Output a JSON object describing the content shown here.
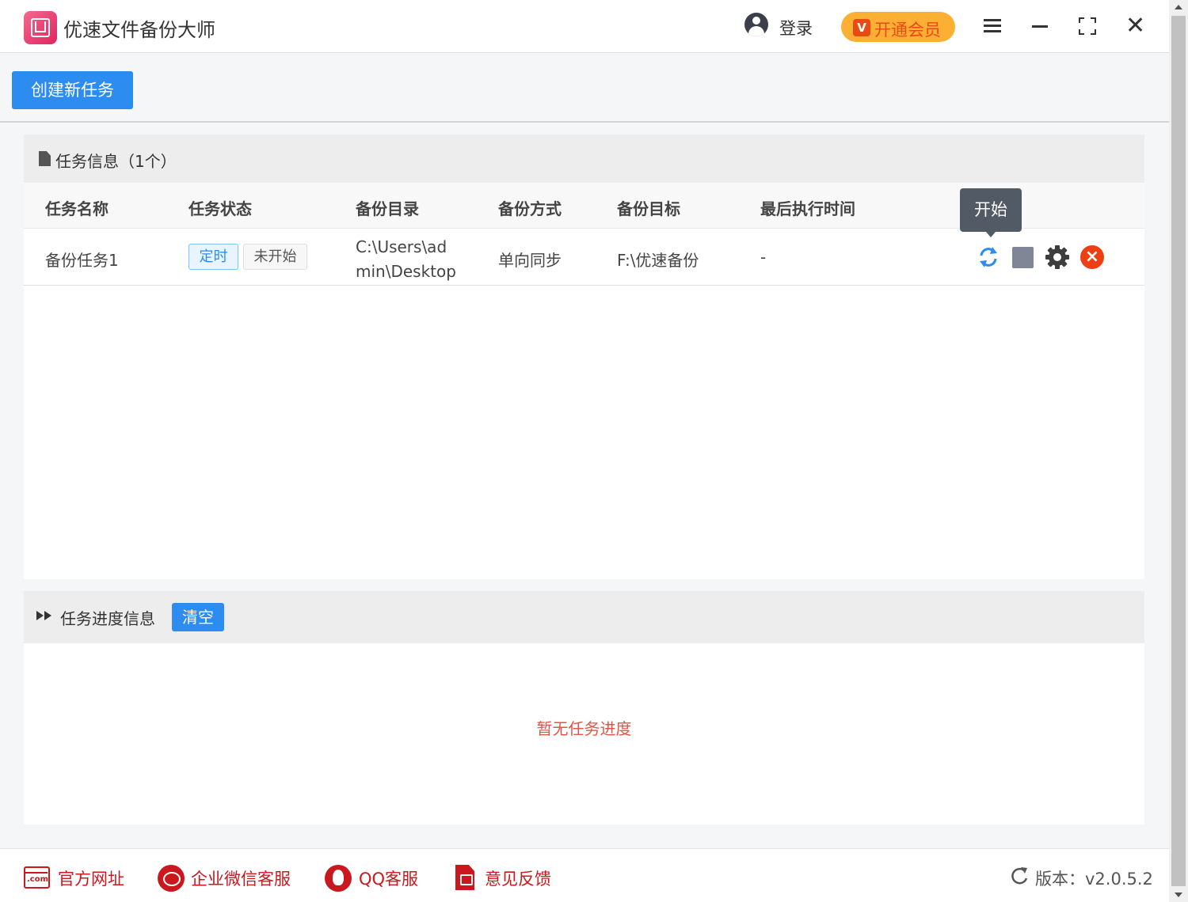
{
  "app": {
    "title": "优速文件备份大师",
    "login_label": "登录",
    "vip_label": "开通会员",
    "vip_badge": "V",
    "close_glyph": "✕"
  },
  "toolbar": {
    "create_task_label": "创建新任务"
  },
  "task_panel": {
    "title": "任务信息（1个）",
    "columns": [
      "任务名称",
      "任务状态",
      "备份目录",
      "备份方式",
      "备份目标",
      "最后执行时间"
    ],
    "rows": [
      {
        "name": "备份任务1",
        "tag_schedule": "定时",
        "tag_status": "未开始",
        "source": "C:\\Users\\admin\\Desktop",
        "mode": "单向同步",
        "target": "F:\\优速备份",
        "last_run": "-",
        "actions": [
          "refresh-icon",
          "stop-icon",
          "gear-icon",
          "delete-icon"
        ]
      }
    ],
    "tooltip": "开始"
  },
  "progress_panel": {
    "title": "任务进度信息",
    "clear_label": "清空",
    "empty_message": "暂无任务进度"
  },
  "footer": {
    "links": [
      {
        "icon": "com-icon",
        "label": "官方网址"
      },
      {
        "icon": "wechat-icon",
        "label": "企业微信客服"
      },
      {
        "icon": "qq-icon",
        "label": "QQ客服"
      },
      {
        "icon": "pdf-icon",
        "label": "意见反馈"
      }
    ],
    "version_label": "版本：v2.0.5.2"
  },
  "colors": {
    "primary": "#2d8cf0",
    "vip_bg": "#fcb033",
    "vip_text": "#e84a16",
    "danger": "#ed3f14",
    "footer_red": "#c9181e",
    "empty_text": "#e0554a"
  }
}
